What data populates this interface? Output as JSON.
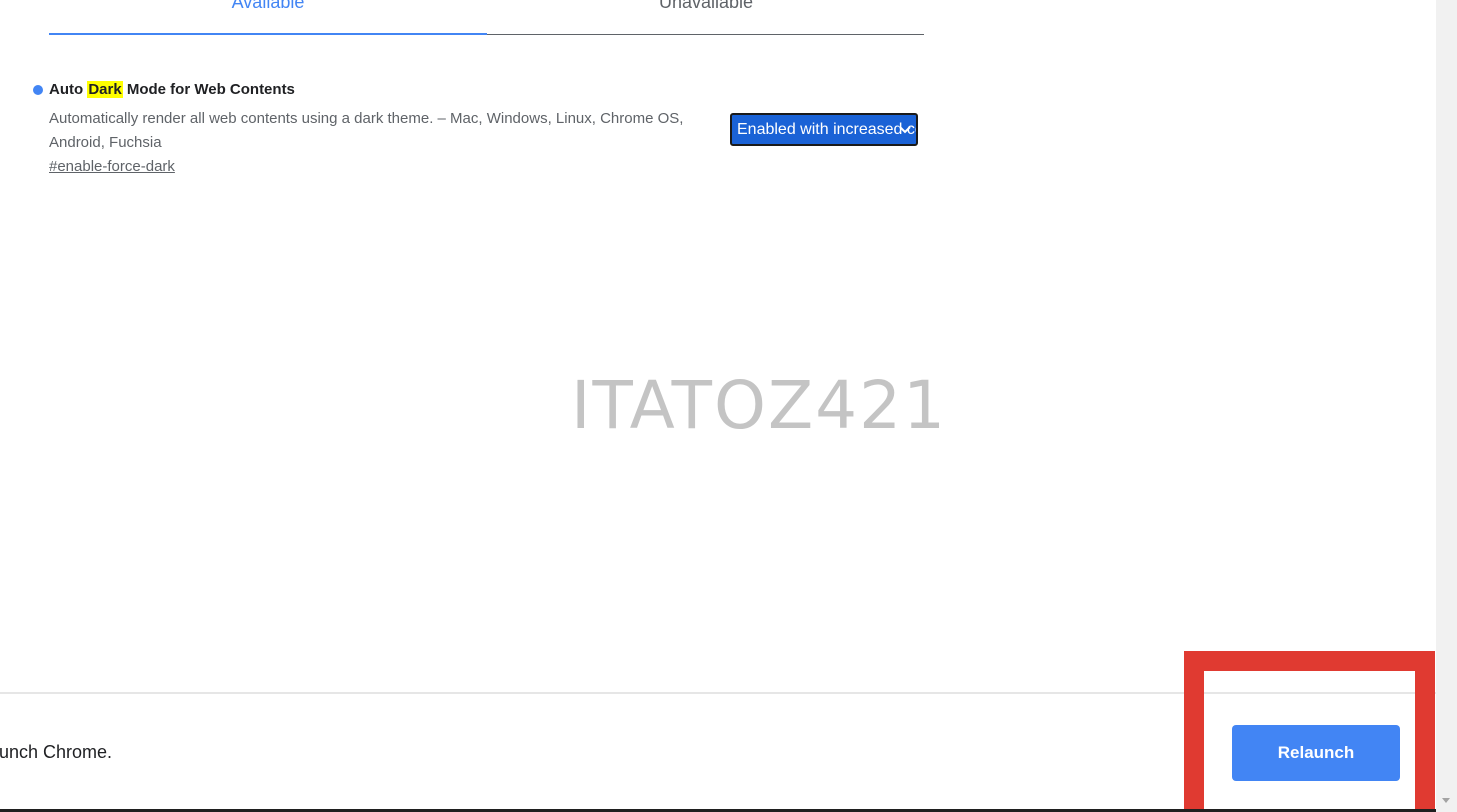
{
  "tabs": [
    {
      "label": "Available",
      "active": true
    },
    {
      "label": "Unavailable",
      "active": false
    }
  ],
  "experiment": {
    "title_before": "Auto ",
    "title_highlight": "Dark",
    "title_after": " Mode for Web Contents",
    "description": "Automatically render all web contents using a dark theme. – Mac, Windows, Linux, Chrome OS, Android, Fuchsia",
    "link": "#enable-force-dark",
    "select_value": "Enabled with increased contrast",
    "bullet_color": "#4285f4",
    "highlight_color": "#ffff00"
  },
  "watermark": "ITATOZ421",
  "footer": {
    "message": "unch Chrome.",
    "relaunch_label": "Relaunch",
    "button_color": "#4285f4",
    "annotation_color": "#e03a31"
  },
  "select_color": "#1a62d6"
}
